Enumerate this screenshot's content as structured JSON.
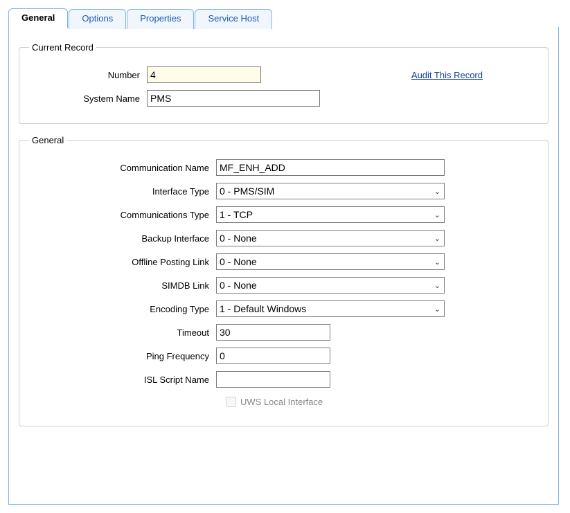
{
  "tabs": {
    "general": "General",
    "options": "Options",
    "properties": "Properties",
    "serviceHost": "Service Host"
  },
  "currentRecord": {
    "legend": "Current Record",
    "numberLabel": "Number",
    "numberValue": "4",
    "systemNameLabel": "System Name",
    "systemNameValue": "PMS",
    "auditLink": "Audit This Record"
  },
  "general": {
    "legend": "General",
    "commNameLabel": "Communication Name",
    "commNameValue": "MF_ENH_ADD",
    "interfaceTypeLabel": "Interface Type",
    "interfaceTypeValue": "0 - PMS/SIM",
    "commTypeLabel": "Communications Type",
    "commTypeValue": "1 - TCP",
    "backupLabel": "Backup Interface",
    "backupValue": "0 - None",
    "offlineLabel": "Offline Posting Link",
    "offlineValue": "0 - None",
    "simdbLabel": "SIMDB Link",
    "simdbValue": "0 - None",
    "encodingLabel": "Encoding Type",
    "encodingValue": "1 - Default Windows",
    "timeoutLabel": "Timeout",
    "timeoutValue": "30",
    "pingLabel": "Ping Frequency",
    "pingValue": "0",
    "islLabel": "ISL Script Name",
    "islValue": "",
    "uwsLabel": "UWS Local Interface"
  }
}
